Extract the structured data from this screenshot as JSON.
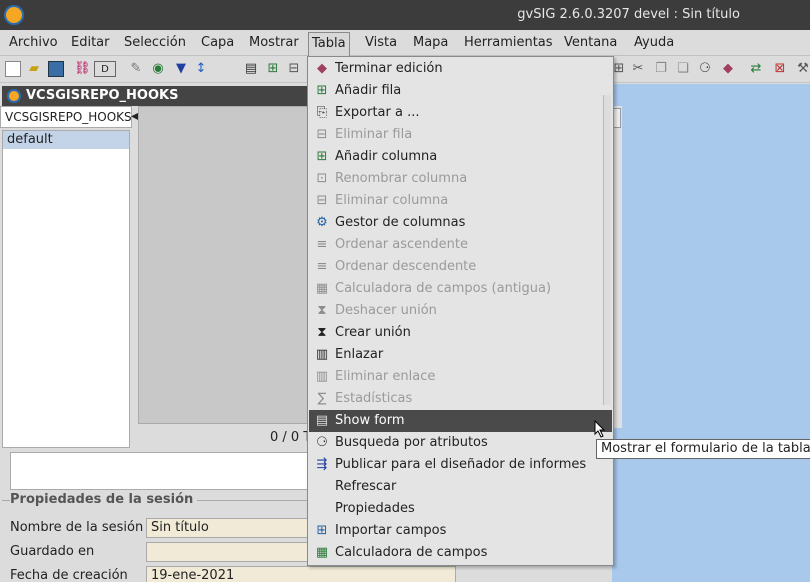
{
  "window": {
    "title": "gvSIG 2.6.0.3207 devel : Sin título"
  },
  "menubar": {
    "items": [
      "Archivo",
      "Editar",
      "Selección",
      "Capa",
      "Mostrar",
      "Tabla",
      "Vista",
      "Mapa",
      "Herramientas",
      "Ventana",
      "Ayuda"
    ],
    "active": "Tabla"
  },
  "toolbar": {
    "icons": [
      "new-icon",
      "open-icon",
      "save-icon",
      "link-icon",
      "dropdown-icon",
      "brush-icon",
      "globe-icon",
      "filter-icon",
      "sort-icon",
      "print-icon",
      "table-add-icon",
      "table-icon",
      "cut-icon",
      "copy-icon",
      "paste-icon",
      "binoculars-icon",
      "cube-icon",
      "transfer-icon",
      "grid-icon"
    ]
  },
  "document": {
    "title": "VCSGISREPO_HOOKS",
    "tab_label": "VCSGISREPO_HOOKS",
    "tables": [
      "default"
    ],
    "row_count": "0 / 0 T"
  },
  "session": {
    "legend": "Propiedades de la sesión",
    "fields": [
      {
        "label": "Nombre de la sesión",
        "value": "Sin título"
      },
      {
        "label": "Guardado en",
        "value": ""
      },
      {
        "label": "Fecha de creación",
        "value": "19-ene-2021"
      }
    ]
  },
  "dropdown": {
    "items": [
      {
        "label": "Terminar edición",
        "enabled": true,
        "icon": "cube-icon"
      },
      {
        "label": "Añadir fila",
        "enabled": true,
        "icon": "add-row-icon"
      },
      {
        "label": "Exportar a ...",
        "enabled": true,
        "icon": "export-icon"
      },
      {
        "label": "Eliminar fila",
        "enabled": false,
        "icon": "delete-row-icon"
      },
      {
        "label": "Añadir columna",
        "enabled": true,
        "icon": "add-column-icon"
      },
      {
        "label": "Renombrar columna",
        "enabled": false,
        "icon": "rename-column-icon"
      },
      {
        "label": "Eliminar columna",
        "enabled": false,
        "icon": "delete-column-icon"
      },
      {
        "label": "Gestor de columnas",
        "enabled": true,
        "icon": "column-manager-icon"
      },
      {
        "label": "Ordenar ascendente",
        "enabled": false,
        "icon": "sort-asc-icon"
      },
      {
        "label": "Ordenar descendente",
        "enabled": false,
        "icon": "sort-desc-icon"
      },
      {
        "label": "Calculadora de campos (antigua)",
        "enabled": false,
        "icon": "calculator-old-icon"
      },
      {
        "label": "Deshacer unión",
        "enabled": false,
        "icon": "undo-join-icon"
      },
      {
        "label": "Crear unión",
        "enabled": true,
        "icon": "join-icon"
      },
      {
        "label": "Enlazar",
        "enabled": true,
        "icon": "link-table-icon"
      },
      {
        "label": "Eliminar enlace",
        "enabled": false,
        "icon": "unlink-icon"
      },
      {
        "label": "Estadísticas",
        "enabled": false,
        "icon": "statistics-icon"
      },
      {
        "label": "Show form",
        "enabled": true,
        "icon": "form-icon",
        "highlighted": true
      },
      {
        "label": "Busqueda por atributos",
        "enabled": true,
        "icon": "binoculars-icon"
      },
      {
        "label": "Publicar para el diseñador de informes",
        "enabled": true,
        "icon": "publish-icon"
      },
      {
        "label": "Refrescar",
        "enabled": true,
        "icon": ""
      },
      {
        "label": "Propiedades",
        "enabled": true,
        "icon": ""
      },
      {
        "label": "Importar campos",
        "enabled": true,
        "icon": "import-fields-icon"
      },
      {
        "label": "Calculadora de campos",
        "enabled": true,
        "icon": "calculator-icon"
      }
    ]
  },
  "tooltip": {
    "text": "Mostrar el formulario de la tabla"
  }
}
